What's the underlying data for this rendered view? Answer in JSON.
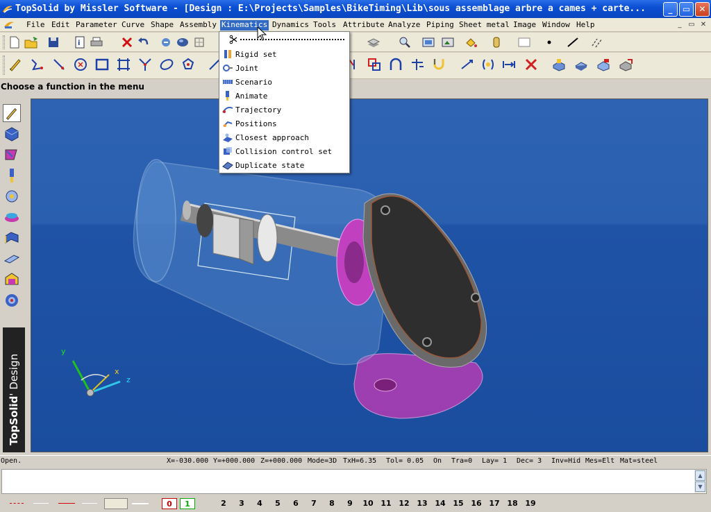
{
  "window": {
    "title": "TopSolid by Missler Software - [Design : E:\\Projects\\Samples\\BikeTiming\\Lib\\sous assemblage arbre a cames + carte...",
    "buttons": {
      "minimize": "_",
      "maximize": "▭",
      "close": "✕"
    }
  },
  "menubar": {
    "items": [
      "File",
      "Edit",
      "Parameter",
      "Curve",
      "Shape",
      "Assembly",
      "Kinematics",
      "Dynamics",
      "Tools",
      "Attribute",
      "Analyze",
      "Piping",
      "Sheet metal",
      "Image",
      "Window",
      "Help"
    ],
    "active": "Kinematics",
    "mdi_buttons": [
      "_",
      "▭",
      "✕"
    ]
  },
  "prompt": {
    "text": "Choose a function in the menu"
  },
  "kinematics_menu": {
    "items": [
      {
        "label": "Rigid set",
        "icon": "rigid-set-icon"
      },
      {
        "label": "Joint",
        "icon": "joint-icon"
      },
      {
        "label": "Scenario",
        "icon": "scenario-icon"
      },
      {
        "label": "Animate",
        "icon": "animate-icon"
      },
      {
        "label": "Trajectory",
        "icon": "trajectory-icon"
      },
      {
        "label": "Positions",
        "icon": "positions-icon"
      },
      {
        "label": "Closest approach",
        "icon": "closest-approach-icon"
      },
      {
        "label": "Collision control set",
        "icon": "collision-control-icon"
      },
      {
        "label": "Duplicate state",
        "icon": "duplicate-state-icon"
      }
    ]
  },
  "viewport": {
    "axes": {
      "x": "x",
      "y": "y",
      "z": "z"
    }
  },
  "brand": {
    "name": "TopSolid",
    "suffix": "' Design"
  },
  "statusbar": {
    "state": "Open.",
    "x": "X=-030.000",
    "y": "Y=+000.000",
    "z": "Z=+000.000",
    "mode": "Mode=3D",
    "txh": "TxH=6.35",
    "tol": "Tol=  0.05",
    "on": "On",
    "tra": "Tra=0",
    "lay": "Lay=  1",
    "dec": "Dec= 3",
    "inv": "Inv=Hid",
    "mes": "Mes=Elt",
    "mat": "Mat=steel"
  },
  "layers": [
    "0",
    "1",
    "2",
    "3",
    "4",
    "5",
    "6",
    "7",
    "8",
    "9",
    "10",
    "11",
    "12",
    "13",
    "14",
    "15",
    "16",
    "17",
    "18",
    "19"
  ],
  "colors": {
    "titlebar": "#0b4fd3",
    "menu_highlight": "#316ac5",
    "viewport_bg": "#2a5fb0",
    "magenta_part": "#c040c0"
  }
}
